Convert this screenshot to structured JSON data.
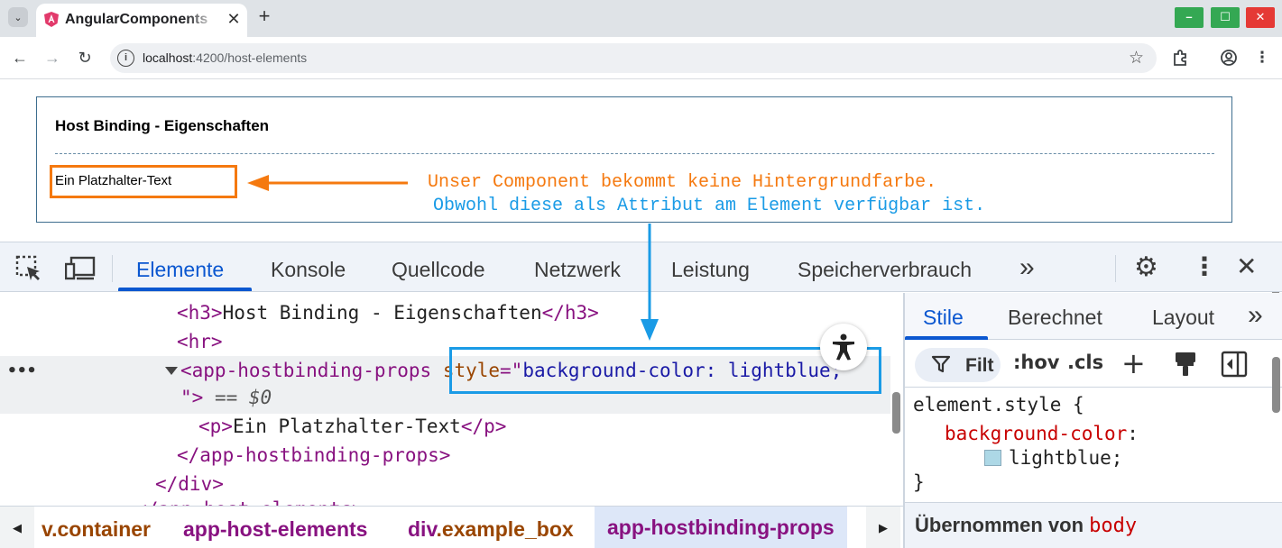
{
  "browser": {
    "tab_title": "AngularComponents",
    "tab_close": "✕",
    "new_tab": "+",
    "window_controls": {
      "minimize": "–",
      "maximize": "☐",
      "close": "✕"
    },
    "url_host": "localhost",
    "url_path": ":4200/host-elements"
  },
  "page": {
    "title": "Host Binding - Eigenschaften",
    "placeholder_text": "Ein Platzhalter-Text",
    "annotation_line1": "Unser Component bekommt keine Hintergrundfarbe.",
    "annotation_line2": "Obwohl diese als Attribut am Element verfügbar ist."
  },
  "devtools": {
    "tabs": [
      "Elemente",
      "Konsole",
      "Quellcode",
      "Netzwerk",
      "Leistung",
      "Speicherverbrauch"
    ],
    "more": "»",
    "dom": {
      "h3_open": "<h3>",
      "h3_text": "Host Binding - Eigenschaften",
      "h3_close": "</h3>",
      "hr": "<hr>",
      "comp_open": "<app-hostbinding-props",
      "attr_name": "style",
      "attr_eq": "=\"",
      "attr_value": "background-color: lightblue;",
      "comp_close_quote": "\">",
      "eq_dollar": " == $0",
      "p_open": "<p>",
      "p_text": "Ein Platzhalter-Text",
      "p_close": "</p>",
      "comp_end": "</app-hostbinding-props>",
      "div_end": "</div>",
      "cut_line": "</app-host-elements>",
      "ellipsis": "•••"
    },
    "breadcrumbs": {
      "item1_tag": "",
      "item1_cls": "v.container",
      "item2": "app-host-elements",
      "item3_tag": "div",
      "item3_cls": ".example_box",
      "item4": "app-hostbinding-props"
    },
    "styles": {
      "tabs": [
        "Stile",
        "Berechnet",
        "Layout"
      ],
      "filter": "Filt",
      "hov": ":hov",
      "cls": ".cls",
      "selector": "element.style {",
      "property": "background-color",
      "colon": ":",
      "value": "lightblue;",
      "close": "}",
      "inherited_label": "Übernommen von",
      "inherited_from": "body"
    }
  },
  "colors": {
    "annotation_orange": "#f5790f",
    "annotation_blue": "#1a9be6",
    "accent": "#0b57d0",
    "swatch": "#add8e6"
  }
}
